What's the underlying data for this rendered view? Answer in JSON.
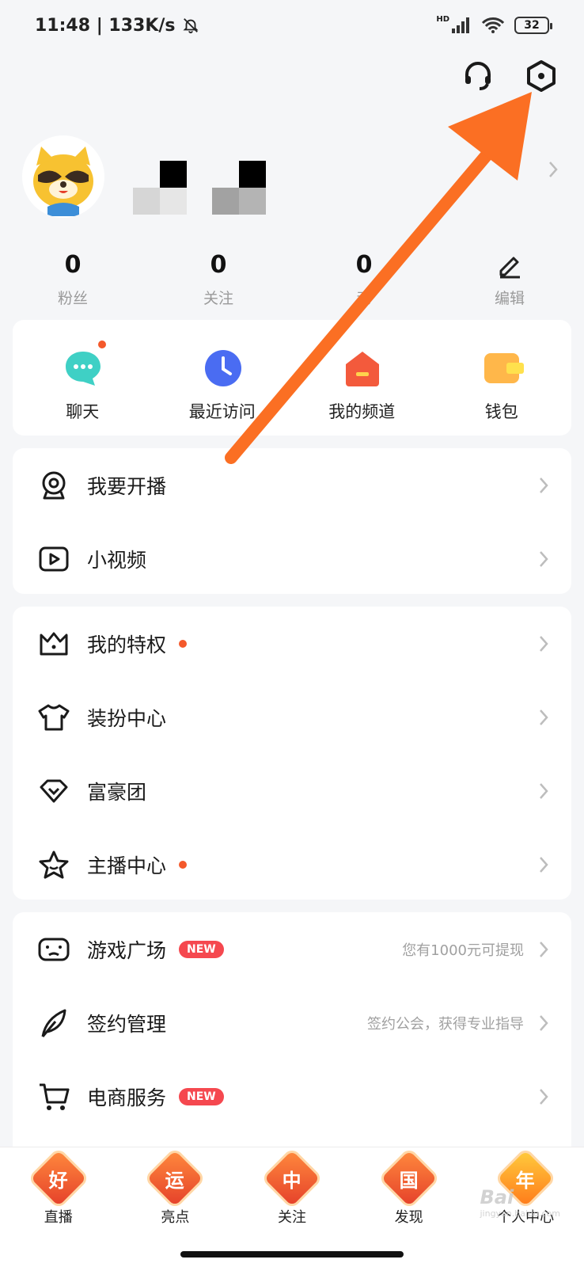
{
  "status_bar": {
    "time": "11:48",
    "speed": "133K/s",
    "battery": "32",
    "hd": "HD"
  },
  "profile": {},
  "stats": [
    {
      "value": "0",
      "label": "粉丝"
    },
    {
      "value": "0",
      "label": "关注"
    },
    {
      "value": "0",
      "label": "动"
    }
  ],
  "edit_label": "编辑",
  "quick_actions": [
    {
      "label": "聊天",
      "color": "#3fd0c5"
    },
    {
      "label": "最近访问",
      "color": "#4a6cf2"
    },
    {
      "label": "我的频道",
      "color": "#f35a3c"
    },
    {
      "label": "钱包",
      "color": "#ffb74a"
    }
  ],
  "menu_group_1": [
    {
      "label": "我要开播",
      "icon": "webcam-icon"
    },
    {
      "label": "小视频",
      "icon": "play-video-icon"
    }
  ],
  "menu_group_2": [
    {
      "label": "我的特权",
      "icon": "crown-icon",
      "dot": true
    },
    {
      "label": "装扮中心",
      "icon": "tshirt-icon"
    },
    {
      "label": "富豪团",
      "icon": "diamond-icon"
    },
    {
      "label": "主播中心",
      "icon": "star-icon",
      "dot": true
    }
  ],
  "menu_group_3": [
    {
      "label": "游戏广场",
      "icon": "gamepad-icon",
      "badge": "NEW",
      "hint": "您有1000元可提现"
    },
    {
      "label": "签约管理",
      "icon": "feather-icon",
      "hint": "签约公会，获得专业指导"
    },
    {
      "label": "电商服务",
      "icon": "cart-icon",
      "badge": "NEW"
    }
  ],
  "tabs": [
    {
      "char": "好",
      "label": "直播"
    },
    {
      "char": "运",
      "label": "亮点"
    },
    {
      "char": "中",
      "label": "关注"
    },
    {
      "char": "国",
      "label": "发现"
    },
    {
      "char": "年",
      "label": "个人中心"
    }
  ],
  "watermark": {
    "text": "Bai",
    "sub": "jingyan.baidu.com"
  },
  "colors": {
    "accent_dot": "#f4592b",
    "arrow": "#fb6f23",
    "new_badge": "#f5484f"
  }
}
